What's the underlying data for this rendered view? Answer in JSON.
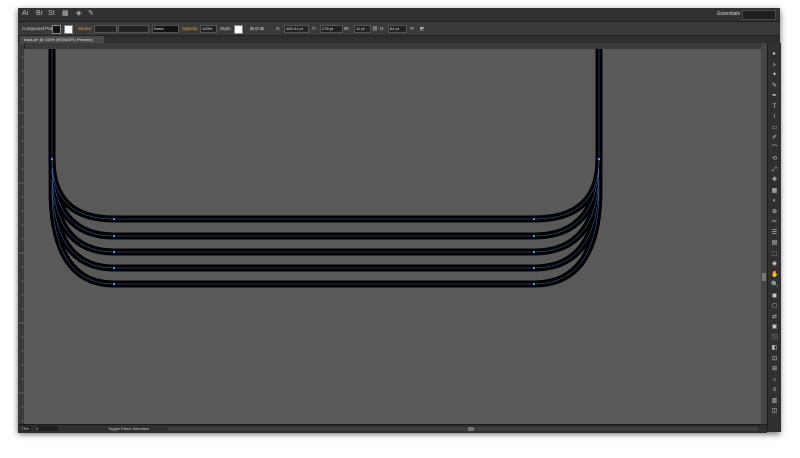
{
  "app": {
    "workspace": "Essentials",
    "icons": [
      "illustrator-logo-icon",
      "bridge-icon",
      "stock-icon",
      "arrange-icon",
      "gpu-icon",
      "feather-icon"
    ]
  },
  "control_bar": {
    "selection_type": "Compound Path",
    "stroke_label": "Stroke:",
    "stroke_value": "",
    "style_label": "Basic",
    "opacity_label": "Opacity:",
    "opacity_value": "100%",
    "style2_label": "Style:",
    "x_value": "465.31 pt",
    "y_value": "278 pt",
    "w_value": "11 pt",
    "h_value": "64 pt"
  },
  "document_tab": {
    "label": "track.ai* @ 100% (RGB/GPU Preview)"
  },
  "status_bar": {
    "zoom": "73%",
    "artboard": "1",
    "status_text": "Toggle Direct Selection"
  },
  "canvas": {
    "background": "#595959",
    "stroke_color": "#000000",
    "anchor_color": "#4d8ff0"
  }
}
